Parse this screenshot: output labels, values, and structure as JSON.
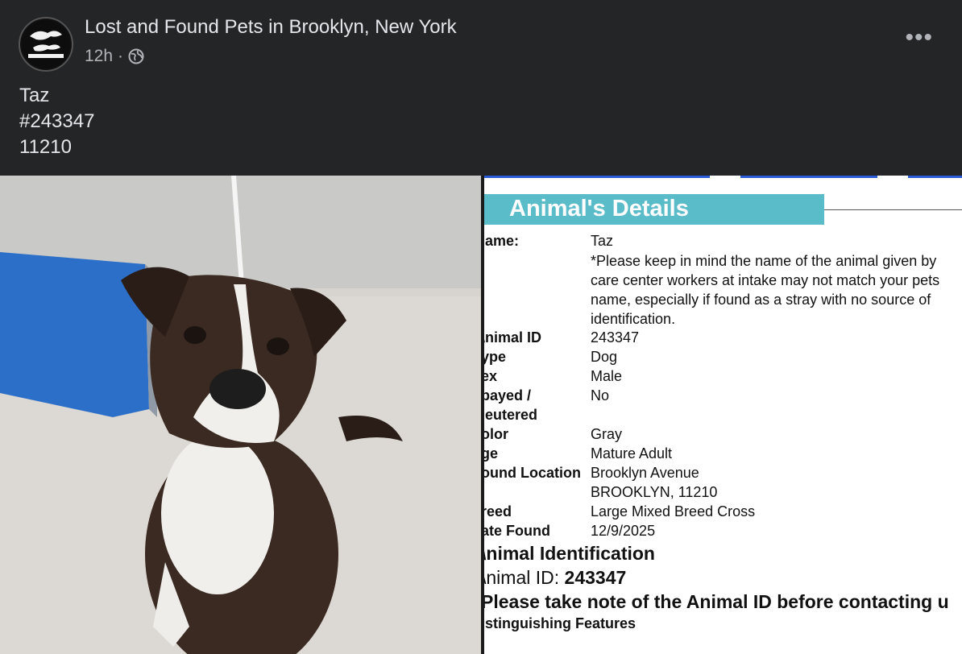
{
  "post": {
    "page_name": "Lost and Found Pets in Brooklyn, New York",
    "time": "12h",
    "separator": "·",
    "privacy_icon": "globe-icon",
    "more_icon": "more-options-icon",
    "more_label": "•••",
    "text_lines": [
      "Taz",
      "#243347",
      "11210"
    ]
  },
  "details": {
    "title": "Animal's Details",
    "name_label": "lame:",
    "name_value": "Taz",
    "name_note": "*Please keep in mind the name of the animal given by care center workers at intake may not match your pets name, especially if found as a stray with no source of identification.",
    "fields": [
      {
        "label": "\\nimal ID",
        "value": "243347"
      },
      {
        "label": "ype",
        "value": "Dog"
      },
      {
        "label": "ex",
        "value": "Male"
      },
      {
        "label": "payed /",
        "value": "No"
      },
      {
        "label": "leutered",
        "value": ""
      },
      {
        "label": "olor",
        "value": "Gray"
      },
      {
        "label": "ge",
        "value": "Mature Adult"
      },
      {
        "label": "ound Location",
        "value": "Brooklyn Avenue"
      },
      {
        "label": "",
        "value": "BROOKLYN, 11210"
      },
      {
        "label": "reed",
        "value": "Large Mixed Breed Cross"
      },
      {
        "label": "ate Found",
        "value": "12/9/2025"
      }
    ],
    "identification_heading": "\\nimal Identification",
    "animal_id_prefix": "\\nimal ID: ",
    "animal_id_value": "243347",
    "notice": "Please take note of the Animal ID before contacting u",
    "distinguishing": "istinguishing Features"
  },
  "colors": {
    "background": "#242526",
    "banner": "#5bbcc9",
    "text_primary": "#e4e6eb",
    "text_secondary": "#b0b3b8"
  }
}
